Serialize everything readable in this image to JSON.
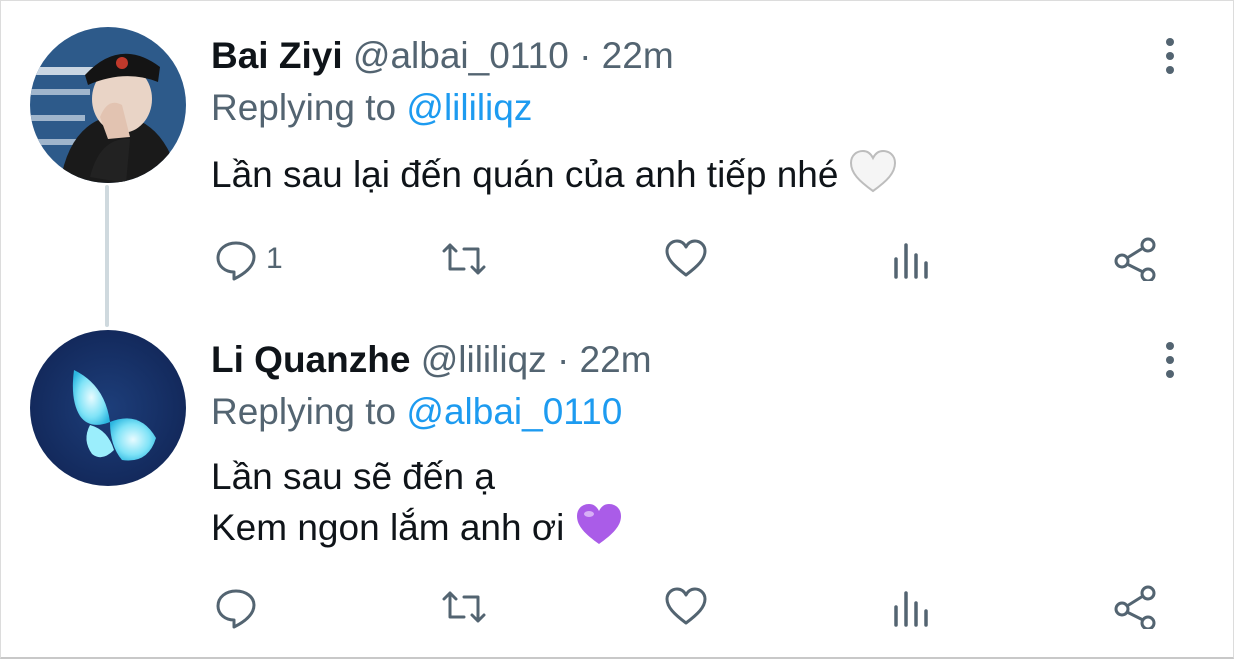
{
  "tweets": [
    {
      "name": "Bai Ziyi",
      "handle": "@albai_0110",
      "time": "22m",
      "replying_prefix": "Replying to",
      "replying_to": "@lililiqz",
      "text_lines": [
        "Lần sau lại đến quán của anh tiếp nhé"
      ],
      "emoji": "white-heart-emoji",
      "reply_count": "1",
      "avatar": "person-in-cap-photo"
    },
    {
      "name": "Li Quanzhe",
      "handle": "@lililiqz",
      "time": "22m",
      "replying_prefix": "Replying to",
      "replying_to": "@albai_0110",
      "text_lines": [
        "Lần sau sẽ đến ạ",
        "Kem ngon lắm anh ơi"
      ],
      "emoji": "purple-heart-emoji",
      "reply_count": "",
      "avatar": "glowing-butterfly-photo"
    }
  ],
  "separator": "·",
  "colors": {
    "text": "#0f1419",
    "secondary": "#536471",
    "link": "#1d9bf0",
    "thread_line": "#cfd9de",
    "purple_heart": "#aa5ce8"
  }
}
